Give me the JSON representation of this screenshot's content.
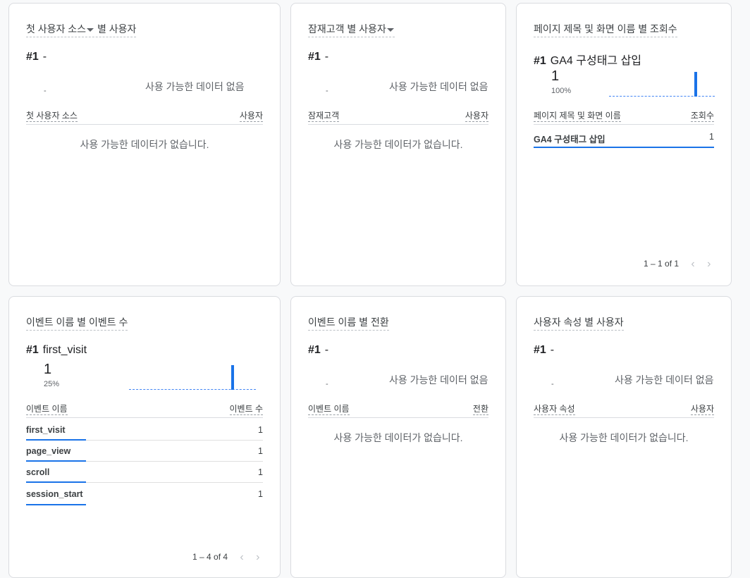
{
  "empty_small": "-",
  "no_data_short": "사용 가능한 데이터 없음",
  "no_data_long": "사용 가능한 데이터가 없습니다.",
  "rank_label": "#1",
  "cards": [
    {
      "title": "첫 사용자 소스",
      "title_suffix": "별 사용자",
      "rank_value": "-",
      "col_left": "첫 사용자 소스",
      "col_right": "사용자"
    },
    {
      "title": "잠재고객 별 사용자",
      "rank_value": "-",
      "col_left": "잠재고객",
      "col_right": "사용자"
    },
    {
      "title": "페이지 제목 및 화면 이름 별 조회수",
      "rank_value": "GA4 구성태그 삽입",
      "big_value": "1",
      "pct": "100%",
      "col_left": "페이지 제목 및 화면 이름",
      "col_right": "조회수",
      "rows": [
        {
          "label": "GA4 구성태그 삽입",
          "value": "1",
          "bar": 1.0
        }
      ],
      "pager": "1 – 1 of 1"
    },
    {
      "title": "이벤트 이름 별 이벤트 수",
      "rank_value": "first_visit",
      "big_value": "1",
      "pct": "25%",
      "col_left": "이벤트 이름",
      "col_right": "이벤트 수",
      "rows": [
        {
          "label": "first_visit",
          "value": "1",
          "bar": 1.0
        },
        {
          "label": "page_view",
          "value": "1",
          "bar": 1.0
        },
        {
          "label": "scroll",
          "value": "1",
          "bar": 1.0
        },
        {
          "label": "session_start",
          "value": "1",
          "bar": 1.0
        }
      ],
      "pager": "1 – 4 of 4"
    },
    {
      "title": "이벤트 이름 별 전환",
      "rank_value": "-",
      "col_left": "이벤트 이름",
      "col_right": "전환"
    },
    {
      "title": "사용자 속성 별 사용자",
      "rank_value": "-",
      "col_left": "사용자 속성",
      "col_right": "사용자"
    }
  ],
  "icons": {
    "prev": "chevron-left-icon",
    "next": "chevron-right-icon",
    "dropdown": "arrow-drop-down-icon"
  }
}
